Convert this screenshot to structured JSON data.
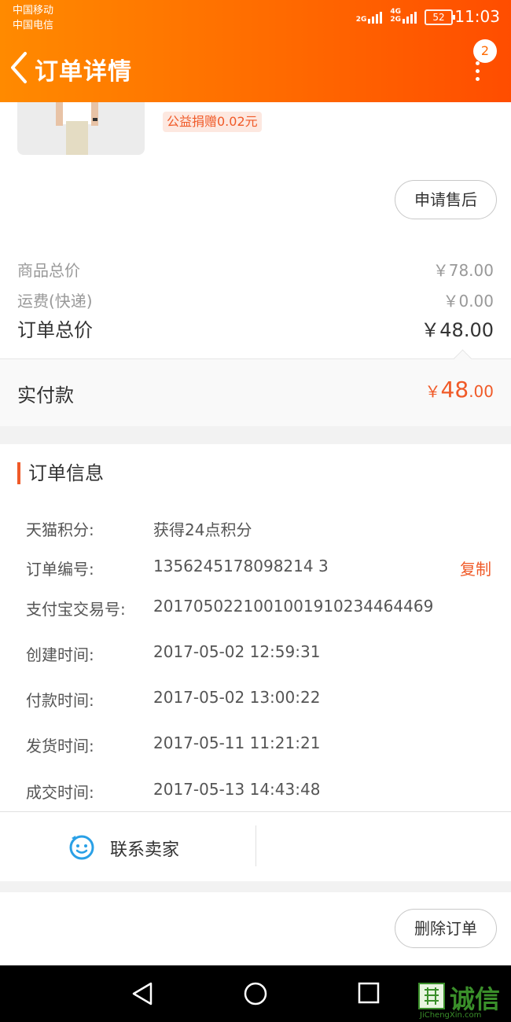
{
  "status_bar": {
    "carrier1": "中国移动",
    "carrier2": "中国电信",
    "net1": "2G",
    "net2a": "4G",
    "net2b": "2G",
    "battery": "52",
    "time": "11:03"
  },
  "header": {
    "title": "订单详情",
    "badge": "2",
    "back_icon": "chevron-left-icon",
    "more_icon": "more-vertical-icon"
  },
  "product": {
    "donation": "公益捐赠0.02元"
  },
  "buttons": {
    "after_sale": "申请售后",
    "delete_order": "删除订单",
    "copy": "复制"
  },
  "prices": {
    "goods_total_label": "商品总价",
    "goods_total_value": "￥78.00",
    "shipping_label": "运费(快递)",
    "shipping_value": "￥0.00",
    "order_total_label": "订单总价",
    "order_total_value": "￥48.00",
    "paid_label": "实付款",
    "paid_currency": "￥",
    "paid_int": "48",
    "paid_dec": ".00"
  },
  "order_info": {
    "title": "订单信息",
    "rows": [
      {
        "label": "天猫积分:",
        "value": "获得24点积分"
      },
      {
        "label": "订单编号:",
        "value": "1356245178098214 3"
      },
      {
        "label": "支付宝交易号:",
        "value": "2017050221001001910234464469"
      },
      {
        "label": "创建时间:",
        "value": "2017-05-02 12:59:31"
      },
      {
        "label": "付款时间:",
        "value": "2017-05-02 13:00:22"
      },
      {
        "label": "发货时间:",
        "value": "2017-05-11 11:21:21"
      },
      {
        "label": "成交时间:",
        "value": "2017-05-13 14:43:48"
      }
    ]
  },
  "contact": {
    "label": "联系卖家",
    "icon": "chat-smiley-icon"
  },
  "watermark": {
    "text": "诚信",
    "sub": "JiChengXin.com"
  },
  "colors": {
    "accent": "#f05a28",
    "header_start": "#ff8a00",
    "header_end": "#ff4d00",
    "contact_icon": "#2aa0e6"
  }
}
